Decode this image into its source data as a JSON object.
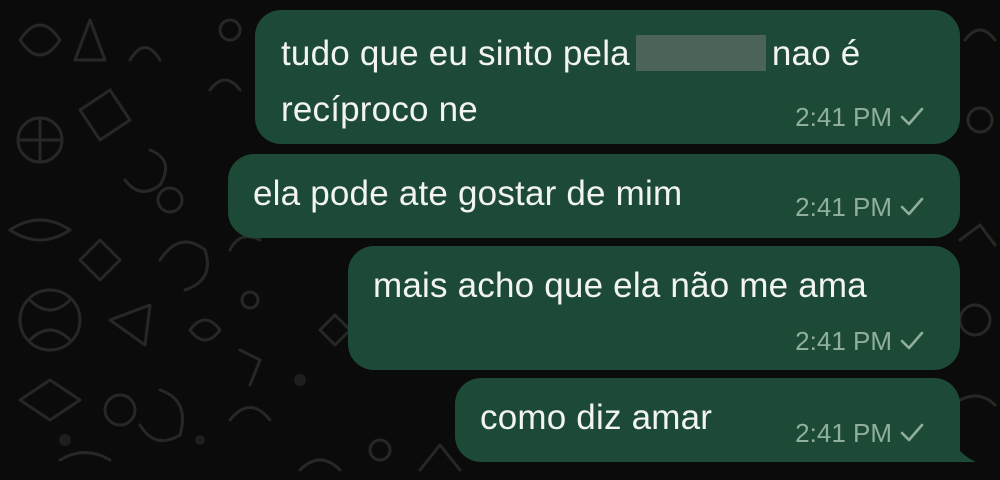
{
  "messages": [
    {
      "text_before": "tudo que eu sinto pela",
      "redacted": true,
      "text_after": "nao é",
      "line2": "recíproco ne",
      "time": "2:41 PM",
      "status": "sent-check-icon"
    },
    {
      "text": "ela pode ate gostar de mim",
      "time": "2:41 PM",
      "status": "sent-check-icon"
    },
    {
      "text": "mais acho que ela não me ama",
      "time": "2:41 PM",
      "status": "sent-check-icon"
    },
    {
      "text": "como diz amar",
      "time": "2:41 PM",
      "status": "sent-check-icon"
    }
  ],
  "colors": {
    "background": "#0b0b0b",
    "bubble": "#1d4a37",
    "text": "#f2f4f3",
    "meta": "#8fae9d",
    "doodle": "#262826"
  }
}
